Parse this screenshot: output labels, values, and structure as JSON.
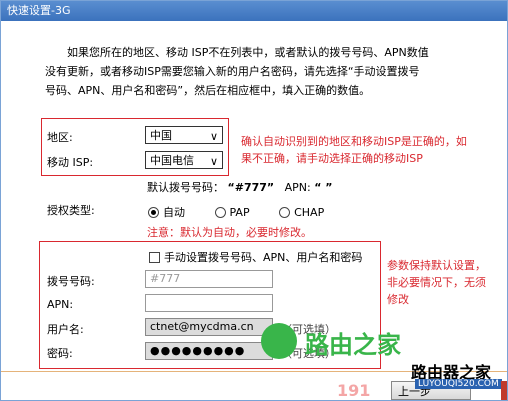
{
  "window": {
    "title": "快速设置-3G"
  },
  "intro": {
    "line1": "如果您所在的地区、移动 ISP不在列表中，或者默认的拨号号码、APN数值",
    "line2": "没有更新，或者移动ISP需要您输入新的用户名密码，请先选择“手动设置拨号",
    "line3": "号码、APN、用户名和密码”，然后在相应框中，填入正确的数值。"
  },
  "region": {
    "label": "地区:",
    "value": "中国",
    "isp_label": "移动 ISP:",
    "isp_value": "中国电信",
    "note_line1": "确认自动识别到的地区和移动ISP是正确的，如",
    "note_line2": "果不正确，请手动选择正确的移动ISP"
  },
  "default_dial": {
    "label": "默认拨号号码：",
    "number": "“#777”",
    "apn_label": "APN:",
    "apn_value": "“ ”"
  },
  "auth": {
    "label": "授权类型:",
    "options": [
      "自动",
      "PAP",
      "CHAP"
    ],
    "selected": "自动",
    "note": "注意：默认为自动，必要时修改。"
  },
  "manual": {
    "checkbox_label": "手动设置拨号号码、APN、用户名和密码",
    "dial_label": "拨号号码:",
    "dial_placeholder": "#777",
    "apn_label": "APN:",
    "user_label": "用户名:",
    "user_value": "ctnet@mycdma.cn",
    "user_hint": "（可选填）",
    "pass_label": "密码:",
    "pass_value": "●●●●●●●●●",
    "pass_hint": "（可选填）",
    "note_line1": "参数保持默认设置，",
    "note_line2": "非必要情况下，无须",
    "note_line3": "修改"
  },
  "buttons": {
    "next": "上一步"
  },
  "watermarks": {
    "logo_text": "路由之家",
    "partial_number": "191",
    "brand": "路由器之家",
    "url": "LUYOUQI520.COM"
  },
  "colors": {
    "title_bar": "#3b72bd",
    "note_red": "#d9282f",
    "logo_green": "#39b54a"
  }
}
